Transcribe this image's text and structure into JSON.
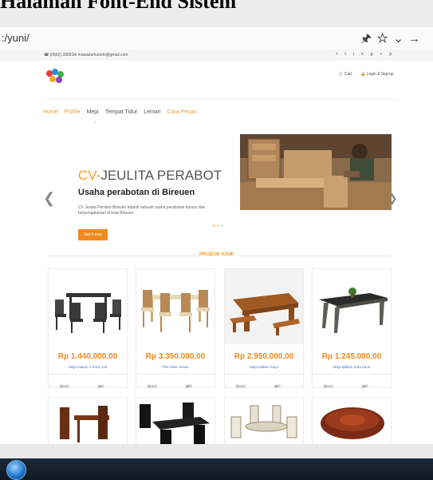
{
  "document": {
    "heading": "Halaman Font-End Sistem"
  },
  "browser": {
    "url": ":/yuni/",
    "icons": [
      "pin-icon",
      "star-icon",
      "chevron-down-icon",
      "arrow-right-icon"
    ]
  },
  "site": {
    "topbar": {
      "phone": "(0562) 33691",
      "email": "muwazarfusinfo@gmail.com",
      "social": [
        "f",
        "t",
        "in",
        "g+",
        "p"
      ]
    },
    "header": {
      "cart": "Cart",
      "login": "Login & Signup"
    },
    "nav": [
      {
        "label": "Home",
        "active": true
      },
      {
        "label": "Profile",
        "active": true
      },
      {
        "label": "Meja",
        "active": false
      },
      {
        "label": "Tempat Tidur",
        "active": false
      },
      {
        "label": "Lemari",
        "active": false
      },
      {
        "label": "Cara Pesan",
        "active": true
      }
    ],
    "slider": {
      "title_accent": "CV-",
      "title_rest": "JEULITA PERABOT",
      "subtitle": "Usaha perabotan di Bireuen",
      "description": "CV Jeulita Perabot Bireuen adalah sebuah usaha perabotan kursus dan berpengalaman di kota Bireuen",
      "button": "Get it now"
    },
    "section_title": "PRODUK KAMI",
    "products": [
      {
        "price": "Rp 1.440.000,00",
        "name": "Meja makan 4 Kursi Jok",
        "detail": "Detail",
        "buy": "Beli"
      },
      {
        "price": "Rp 3.350.000,00",
        "name": "The Olive House",
        "detail": "Detail",
        "buy": "Beli"
      },
      {
        "price": "Rp 2.950.000,00",
        "name": "Meja Makan Kayu",
        "detail": "Detail",
        "buy": "Beli"
      },
      {
        "price": "Rp 1.245.000,00",
        "name": "Meja Makan Sofa Kaca",
        "detail": "Detail",
        "buy": "Beli"
      }
    ]
  }
}
